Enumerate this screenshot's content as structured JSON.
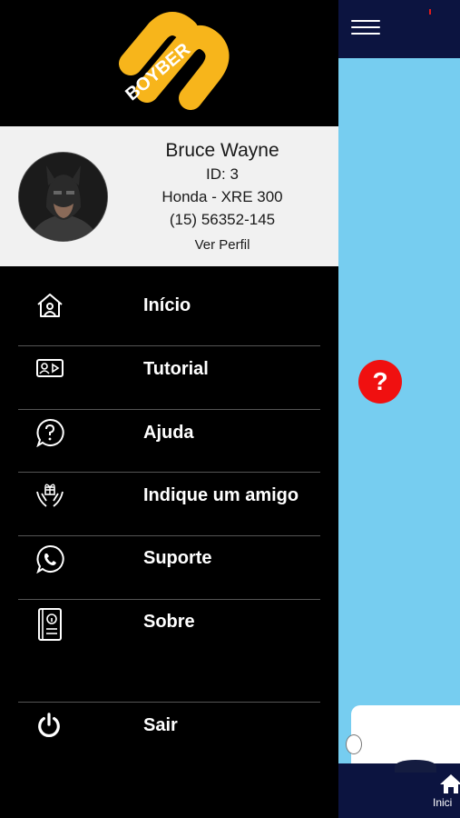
{
  "app": {
    "brand": "BOYBER",
    "colors": {
      "drawer_bg": "#000000",
      "profile_bg": "#f1f1f1",
      "map_bg": "#76cdf0",
      "header_bg": "#0c1440",
      "logo": "#f7b51b",
      "help_fab": "#f01010"
    }
  },
  "profile": {
    "name": "Bruce Wayne",
    "id_text": "ID: 3",
    "vehicle": "Honda - XRE 300",
    "phone": "(15) 56352-145",
    "view_profile": "Ver Perfil"
  },
  "menu": {
    "items": [
      {
        "label": "Início",
        "icon": "home-icon"
      },
      {
        "label": "Tutorial",
        "icon": "id-card-icon"
      },
      {
        "label": "Ajuda",
        "icon": "question-chat-icon"
      },
      {
        "label": "Indique um amigo",
        "icon": "hands-gift-icon"
      },
      {
        "label": "Suporte",
        "icon": "whatsapp-icon"
      },
      {
        "label": "Sobre",
        "icon": "info-book-icon"
      },
      {
        "label": "Sair",
        "icon": "power-icon"
      }
    ]
  },
  "background": {
    "help_symbol": "?",
    "home_tab_label": "Inici"
  }
}
